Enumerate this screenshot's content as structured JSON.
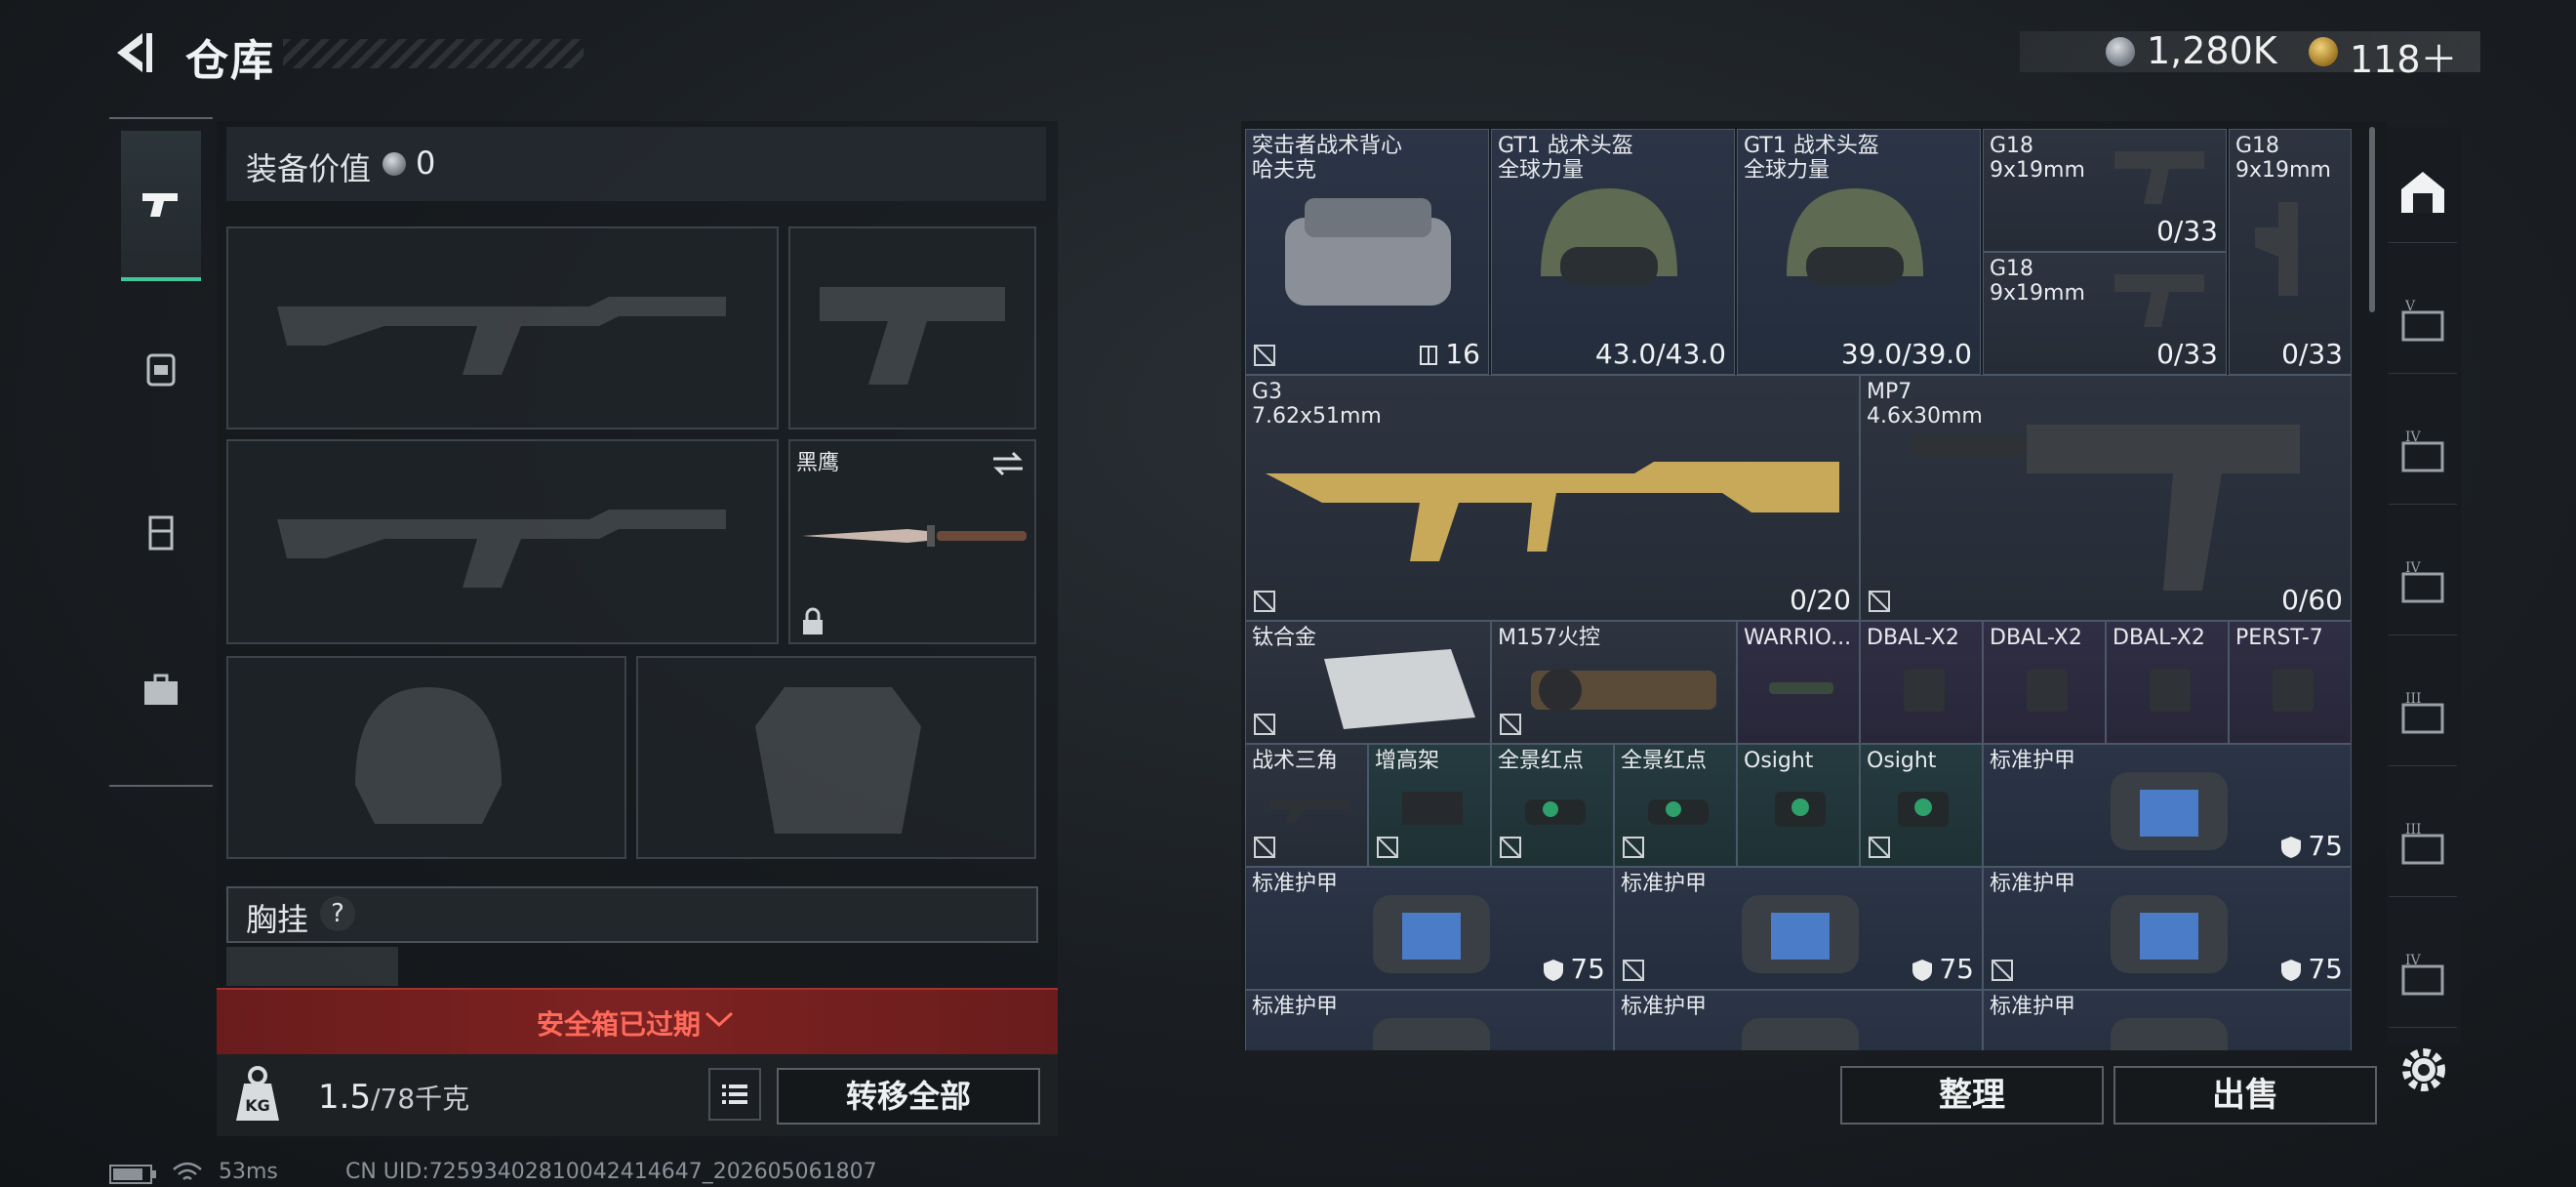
{
  "header": {
    "title": "仓库",
    "money": "1,280K",
    "tickets": "118＋"
  },
  "equipment": {
    "value_label": "装备价值",
    "value": "0",
    "knife_name": "黑鹰",
    "pendant_label": "胸挂",
    "pendant_help": "?",
    "case_banner": "安全箱已过期",
    "weight_value": "1.5",
    "weight_capacity": "/78千克",
    "transfer_all": "转移全部"
  },
  "inventory": {
    "items": [
      {
        "name": "突击者战术背心",
        "sub": "哈夫克",
        "count": "16"
      },
      {
        "name": "GT1 战术头盔",
        "sub": "全球力量",
        "count": "43.0/43.0"
      },
      {
        "name": "GT1 战术头盔",
        "sub": "全球力量",
        "count": "39.0/39.0"
      },
      {
        "name": "G18",
        "sub": "9x19mm",
        "count": "0/33"
      },
      {
        "name": "G18",
        "sub": "9x19mm",
        "count": "0/33"
      },
      {
        "name": "G18",
        "sub": "9x19mm",
        "count": "0/33"
      },
      {
        "name": "G3",
        "sub": "7.62x51mm",
        "count": "0/20"
      },
      {
        "name": "MP7",
        "sub": "4.6x30mm",
        "count": "0/60"
      },
      {
        "name": "钛合金"
      },
      {
        "name": "M157火控"
      },
      {
        "name": "WARRIO..."
      },
      {
        "name": "DBAL-X2"
      },
      {
        "name": "DBAL-X2"
      },
      {
        "name": "DBAL-X2"
      },
      {
        "name": "PERST-7"
      },
      {
        "name": "战术三角"
      },
      {
        "name": "增高架"
      },
      {
        "name": "全景红点"
      },
      {
        "name": "全景红点"
      },
      {
        "name": "Osight"
      },
      {
        "name": "Osight"
      },
      {
        "name": "标准护甲",
        "count": "75"
      },
      {
        "name": "标准护甲",
        "count": "75"
      },
      {
        "name": "标准护甲",
        "count": "75"
      },
      {
        "name": "标准护甲",
        "count": "75"
      },
      {
        "name": "标准护甲"
      },
      {
        "name": "标准护甲"
      },
      {
        "name": "标准护甲"
      }
    ]
  },
  "actions": {
    "sort": "整理",
    "sell": "出售"
  },
  "status": {
    "ping": "53ms",
    "uid": "CN UID:7259340281004241464​7_202605061807"
  },
  "colors": {
    "accent_green": "#3ec69a",
    "warning_red": "#ff6a5a",
    "banner_red": "#7d2222"
  }
}
